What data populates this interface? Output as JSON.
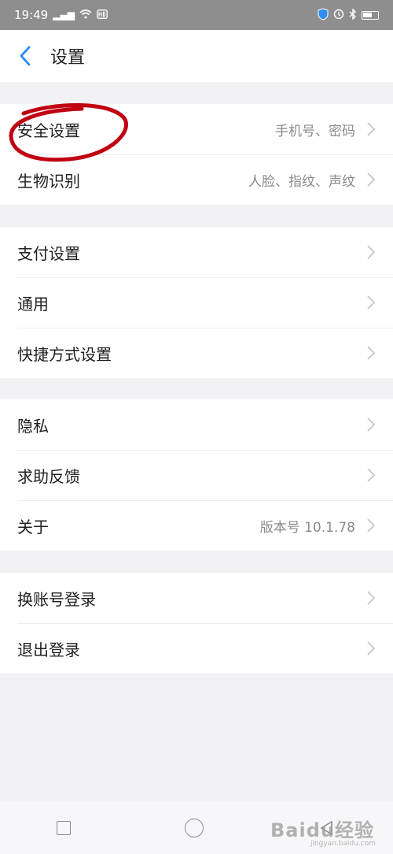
{
  "status_bar": {
    "time": "19:49",
    "icons": [
      "signal-icon",
      "wifi-icon",
      "hd-icon",
      "shield-icon",
      "alarm-icon",
      "bluetooth-icon",
      "battery-icon"
    ]
  },
  "header": {
    "title": "设置"
  },
  "groups": [
    {
      "rows": [
        {
          "label": "安全设置",
          "value": "手机号、密码"
        },
        {
          "label": "生物识别",
          "value": "人脸、指纹、声纹"
        }
      ]
    },
    {
      "rows": [
        {
          "label": "支付设置",
          "value": ""
        },
        {
          "label": "通用",
          "value": ""
        },
        {
          "label": "快捷方式设置",
          "value": ""
        }
      ]
    },
    {
      "rows": [
        {
          "label": "隐私",
          "value": ""
        },
        {
          "label": "求助反馈",
          "value": ""
        },
        {
          "label": "关于",
          "value": "版本号 10.1.78"
        }
      ]
    },
    {
      "rows": [
        {
          "label": "换账号登录",
          "value": ""
        },
        {
          "label": "退出登录",
          "value": ""
        }
      ]
    }
  ],
  "watermark": {
    "text": "Baidu经验",
    "sub": "jingyan.baidu.com"
  },
  "colors": {
    "accent": "#2d8cf0",
    "annotation": "#c00012",
    "status_bar": "#8e8e8e",
    "background": "#f2f2f4"
  }
}
